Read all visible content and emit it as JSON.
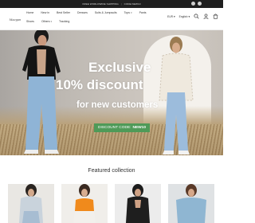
{
  "announcement": {
    "left": "FREE WORLDWIDE SHIPPING",
    "right": "CODE:NEW10"
  },
  "header": {
    "logo_text": "Maegan",
    "nav": [
      {
        "label": "Home",
        "has_dropdown": false
      },
      {
        "label": "New in",
        "has_dropdown": false
      },
      {
        "label": "Best Seller",
        "has_dropdown": false
      },
      {
        "label": "Dresses",
        "has_dropdown": false
      },
      {
        "label": "Suits & Jumpsuits",
        "has_dropdown": false
      },
      {
        "label": "Tops",
        "has_dropdown": true
      },
      {
        "label": "Pants",
        "has_dropdown": false
      },
      {
        "label": "Shoes",
        "has_dropdown": false
      },
      {
        "label": "Others",
        "has_dropdown": true
      },
      {
        "label": "Tracking",
        "has_dropdown": false
      }
    ],
    "currency": "EUR",
    "language": "English",
    "icons": [
      "search-icon",
      "user-icon",
      "cart-icon"
    ]
  },
  "hero": {
    "line1": "Exclusive",
    "line2": "10% discount",
    "line3": "for new customers",
    "promo_label": "DISCOUNT CODE:",
    "promo_code": "NEW10",
    "promo_color": "#4f9a58"
  },
  "featured": {
    "title": "Featured collection"
  }
}
